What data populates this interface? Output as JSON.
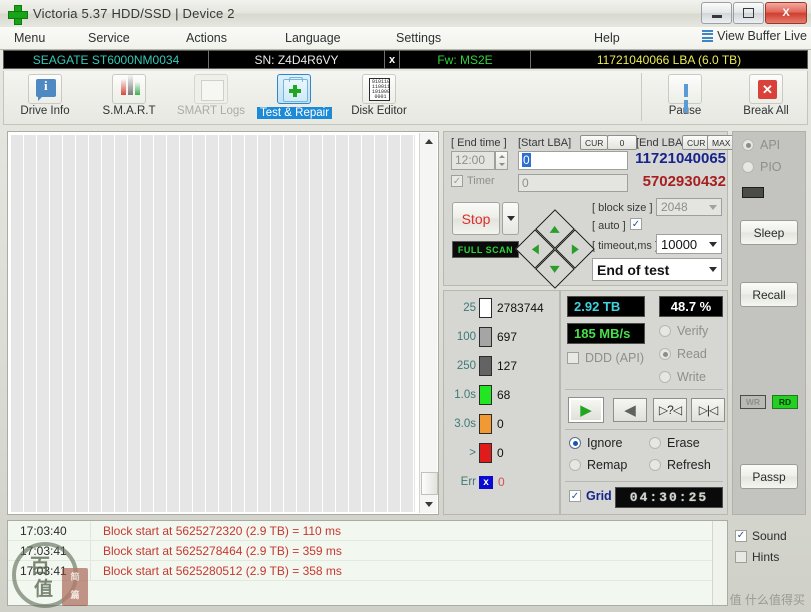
{
  "window": {
    "title": "Victoria 5.37 HDD/SSD | Device 2",
    "app_icon": "green-cross-icon",
    "buttons": {
      "minimize": "minimize-icon",
      "maximize": "maximize-icon",
      "close": "X"
    }
  },
  "menubar": {
    "items": [
      {
        "label": "Menu"
      },
      {
        "label": "Service"
      },
      {
        "label": "Actions"
      },
      {
        "label": "Language"
      },
      {
        "label": "Settings"
      },
      {
        "label": "Help"
      }
    ],
    "view_buffer_live": "View Buffer Live"
  },
  "device_bar": {
    "model": "SEAGATE ST6000NM0034",
    "serial": "SN: Z4D4R6VY",
    "x_mark": "x",
    "firmware": "Fw: MS2E",
    "capacity": "11721040066 LBA (6.0 TB)",
    "colors": {
      "model": "#35c9b6",
      "serial": "#eaeaea",
      "firmware": "#2fd43c",
      "capacity": "#ecec55"
    }
  },
  "toolbar": {
    "items": [
      {
        "label": "Drive Info",
        "icon": "drive-info-icon",
        "state": "normal"
      },
      {
        "label": "S.M.A.R.T",
        "icon": "smart-icon",
        "state": "normal"
      },
      {
        "label": "SMART Logs",
        "icon": "smart-logs-icon",
        "state": "disabled"
      },
      {
        "label": "Test & Repair",
        "icon": "test-repair-icon",
        "state": "selected"
      },
      {
        "label": "Disk Editor",
        "icon": "disk-editor-icon",
        "state": "normal"
      }
    ],
    "right_items": [
      {
        "label": "Pause",
        "icon": "pause-icon"
      },
      {
        "label": "Break All",
        "icon": "break-all-icon"
      }
    ],
    "disk_editor_bits": [
      "010110",
      "110011",
      "101000",
      "0001"
    ]
  },
  "control_panel": {
    "end_time_label": "[ End time ]",
    "end_time_value": "12:00",
    "start_lba_label": "[Start LBA]",
    "start_lba_cur": "CUR",
    "start_lba_zero": "0",
    "start_lba_value": "0",
    "end_lba_label": "[End LBA]",
    "end_lba_cur": "CUR",
    "end_lba_max": "MAX",
    "end_lba_value": "11721040065",
    "timer_label": "Timer",
    "timer_value": "0",
    "current_lba_value": "5702930432",
    "stop_label": "Stop",
    "full_scan_label": "FULL SCAN",
    "block_size_label": "[ block size ]",
    "block_size_value": "2048",
    "auto_label": "[ auto ]",
    "auto_checked": "✓",
    "timeout_label": "[ timeout,ms ]",
    "timeout_value": "10000",
    "end_of_test_value": "End of test",
    "nav_arrows": [
      "up",
      "left",
      "right",
      "down"
    ]
  },
  "legend": {
    "rows": [
      {
        "key": "25",
        "value": "2783744",
        "color": "#ffffff"
      },
      {
        "key": "100",
        "value": "697",
        "color": "#a5a5a5"
      },
      {
        "key": "250",
        "value": "127",
        "color": "#636363"
      },
      {
        "key": "1.0s",
        "value": "68",
        "color": "#22e622"
      },
      {
        "key": "3.0s",
        "value": "0",
        "color": "#f19a33"
      },
      {
        "key": ">",
        "value": "0",
        "color": "#e01b1b"
      },
      {
        "key": "Err",
        "value": "0",
        "color": "#0a0ad0",
        "swatch_text": "x"
      }
    ]
  },
  "stats": {
    "processed": "2.92 TB",
    "percent": "48.7  %",
    "speed": "185 MB/s",
    "ddd_api_label": "DDD (API)",
    "modes": [
      {
        "label": "Verify",
        "selected": false,
        "disabled": true
      },
      {
        "label": "Read",
        "selected": true,
        "disabled": true
      },
      {
        "label": "Write",
        "selected": false,
        "disabled": true
      }
    ],
    "transport_buttons": [
      {
        "name": "play-forward-icon",
        "glyph": "▶"
      },
      {
        "name": "play-reverse-icon",
        "glyph": "◀"
      },
      {
        "name": "random-seek-icon",
        "glyph": "?"
      },
      {
        "name": "butterfly-seek-icon",
        "glyph": "|"
      }
    ],
    "actions": [
      {
        "label": "Ignore",
        "selected": true
      },
      {
        "label": "Erase",
        "selected": false
      },
      {
        "label": "Remap",
        "selected": false
      },
      {
        "label": "Refresh",
        "selected": false
      }
    ],
    "grid_label": "Grid",
    "grid_checked": "✓",
    "elapsed": "04:30:25",
    "colors": {
      "processed": "#3fd2e0",
      "percent": "#ffffff",
      "speed": "#46e04a"
    }
  },
  "rail": {
    "api_label": "API",
    "pio_label": "PIO",
    "sleep_label": "Sleep",
    "recall_label": "Recall",
    "wr_label": "WR",
    "rd_label": "RD",
    "passp_label": "Passp"
  },
  "log": {
    "rows": [
      {
        "time": "17:03:40",
        "message": "Block start at 5625272320 (2.9 TB)  = 110 ms"
      },
      {
        "time": "17:03:41",
        "message": "Block start at 5625278464 (2.9 TB)  = 359 ms"
      },
      {
        "time": "17:03:41",
        "message": "Block start at 5625280512 (2.9 TB)  = 358 ms"
      }
    ]
  },
  "bottom_options": [
    {
      "label": "Sound",
      "checked": true,
      "mark": "✓"
    },
    {
      "label": "Hints",
      "checked": false,
      "mark": ""
    }
  ],
  "watermark": {
    "ring_char": "百",
    "char2": "值",
    "seal_top": "简",
    "seal_bottom": "篇",
    "text": "值 什么值得买"
  }
}
